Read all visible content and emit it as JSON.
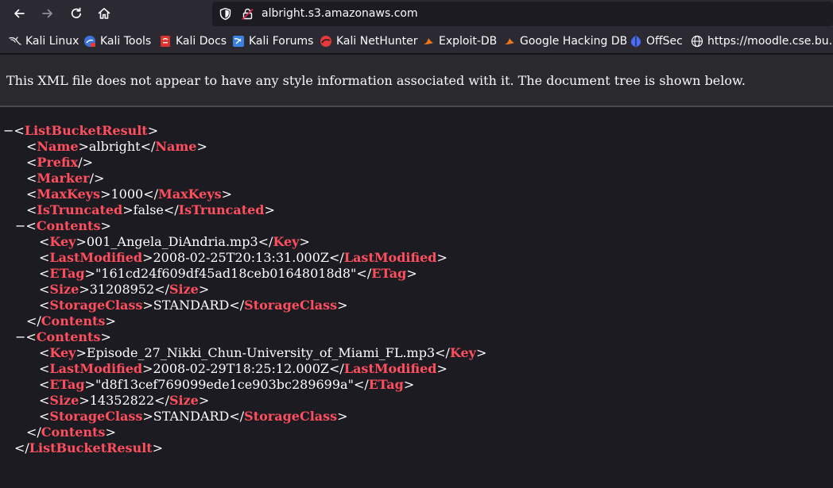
{
  "browser": {
    "url": "albright.s3.amazonaws.com",
    "icons": [
      "back-arrow-icon",
      "forward-arrow-icon",
      "reload-icon",
      "home-icon",
      "shield-icon",
      "lock-icon"
    ]
  },
  "bookmarks": [
    {
      "label": "Kali Linux",
      "icon": "kali-dragon-icon"
    },
    {
      "label": "Kali Tools",
      "icon": "kali-tools-icon"
    },
    {
      "label": "Kali Docs",
      "icon": "kali-docs-icon"
    },
    {
      "label": "Kali Forums",
      "icon": "kali-forums-icon"
    },
    {
      "label": "Kali NetHunter",
      "icon": "nethunter-icon"
    },
    {
      "label": "Exploit-DB",
      "icon": "exploit-db-icon"
    },
    {
      "label": "Google Hacking DB",
      "icon": "ghdb-icon"
    },
    {
      "label": "OffSec",
      "icon": "offsec-icon"
    },
    {
      "label": "https://moodle.cse.bu…",
      "icon": "globe-icon"
    }
  ],
  "xml_notice": "This XML file does not appear to have any style information associated with it. The document tree is shown below.",
  "xml": {
    "toggle": "−",
    "root_tag": "ListBucketResult",
    "name": {
      "tag": "Name",
      "value": "albright"
    },
    "prefix_tag": "Prefix",
    "marker_tag": "Marker",
    "max_keys": {
      "tag": "MaxKeys",
      "value": "1000"
    },
    "is_truncated": {
      "tag": "IsTruncated",
      "value": "false"
    },
    "contents_tag": "Contents",
    "field_tags": {
      "key": "Key",
      "last_modified": "LastModified",
      "etag": "ETag",
      "size": "Size",
      "storage_class": "StorageClass"
    },
    "contents": [
      {
        "key": "001_Angela_DiAndria.mp3",
        "last_modified": "2008-02-25T20:13:31.000Z",
        "etag": "\"161cd24f609df45ad18ceb01648018d8\"",
        "size": "31208952",
        "storage_class": "STANDARD"
      },
      {
        "key": "Episode_27_Nikki_Chun-University_of_Miami_FL.mp3",
        "last_modified": "2008-02-29T18:25:12.000Z",
        "etag": "\"d8f13cef769099ede1ce903bc289699a\"",
        "size": "14352822",
        "storage_class": "STANDARD"
      }
    ]
  },
  "colors": {
    "tag": "#ff4f5e",
    "text": "#ffffff",
    "background": "#1c1b22",
    "toolbar": "#2b2a33",
    "banner": "#2a2a2e"
  }
}
